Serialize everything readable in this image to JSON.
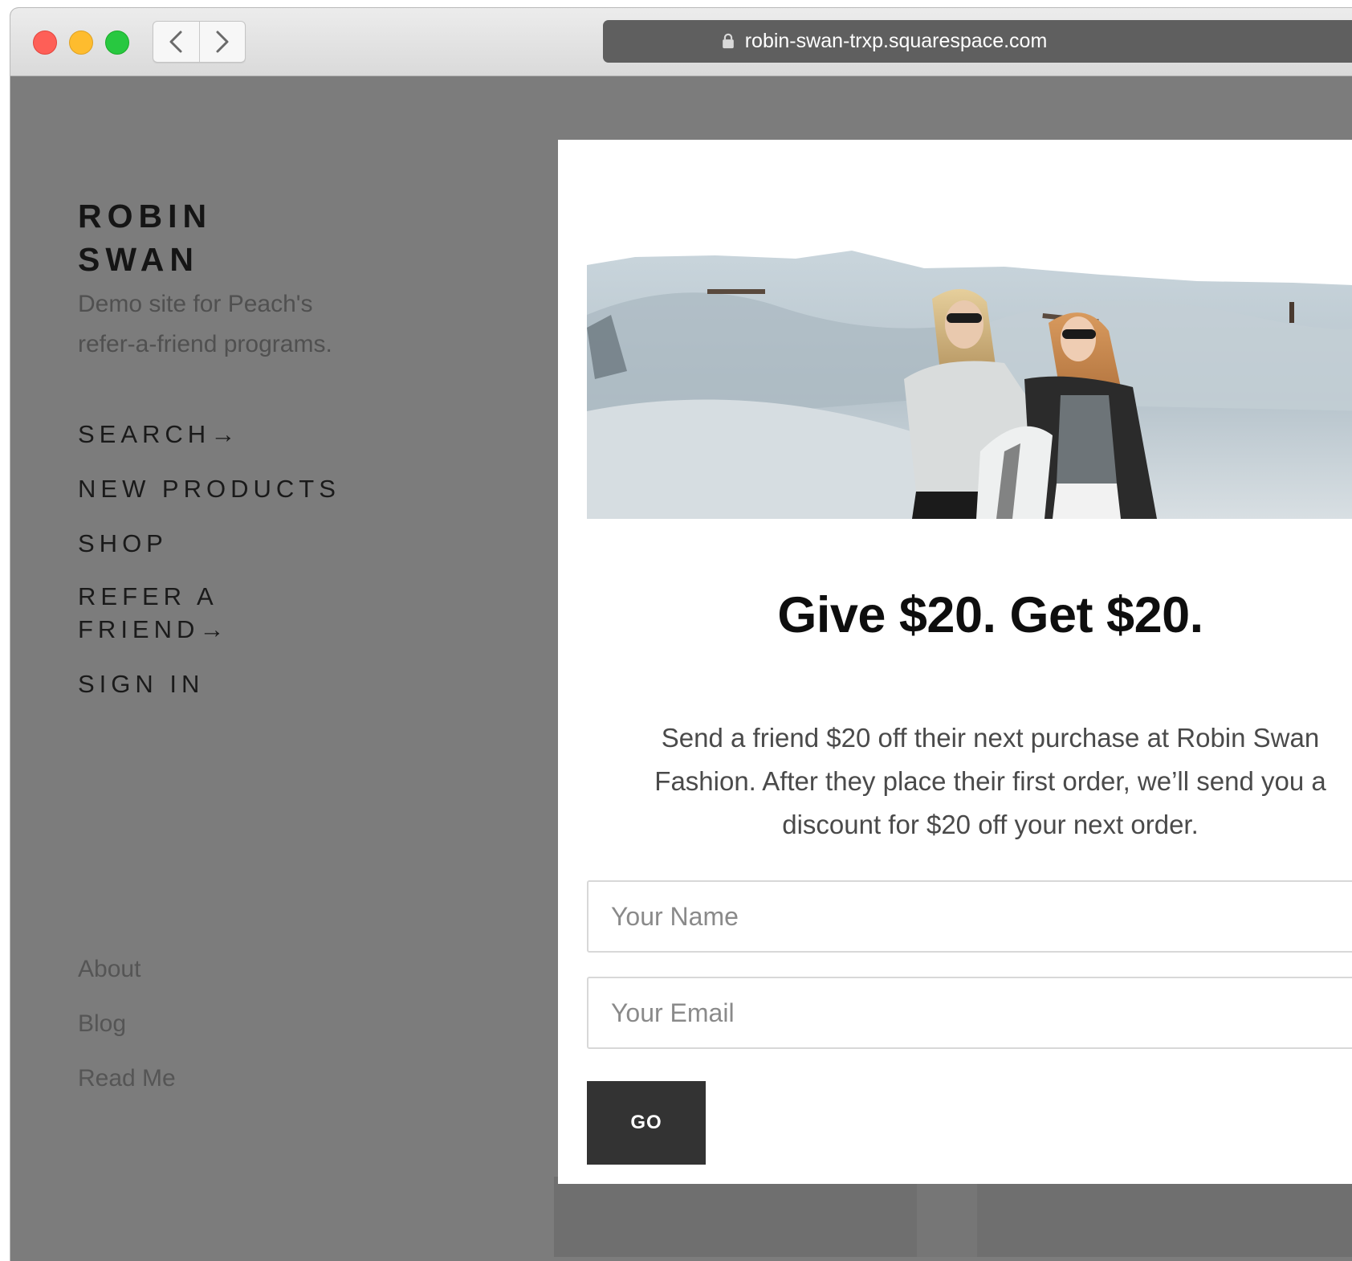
{
  "browser": {
    "url": "robin-swan-trxp.squarespace.com",
    "icons": {
      "back": "chevron-left-icon",
      "forward": "chevron-right-icon",
      "lock": "lock-icon"
    },
    "colors": {
      "close": "#fe5f57",
      "minimize": "#febc2e",
      "maximize": "#28c840"
    }
  },
  "site": {
    "logo_line1": "ROBIN",
    "logo_line2": "SWAN",
    "tagline_line1": "Demo site for Peach's",
    "tagline_line2": "refer-a-friend programs.",
    "nav": {
      "search": "SEARCH→",
      "new_products": "NEW PRODUCTS",
      "shop": "SHOP",
      "refer_line1": "REFER A",
      "refer_line2": "FRIEND→",
      "sign_in": "SIGN IN"
    },
    "footer_nav": {
      "about": "About",
      "blog": "Blog",
      "read_me": "Read Me"
    }
  },
  "modal": {
    "heading": "Give $20. Get $20.",
    "description_line1": "Send a friend $20 off their next purchase at Robin Swan",
    "description_line2": "Fashion. After they place their first order, we’ll send you a",
    "description_line3": "discount for $20 off your next order.",
    "name_placeholder": "Your Name",
    "email_placeholder": "Your Email",
    "go_label": "GO"
  }
}
